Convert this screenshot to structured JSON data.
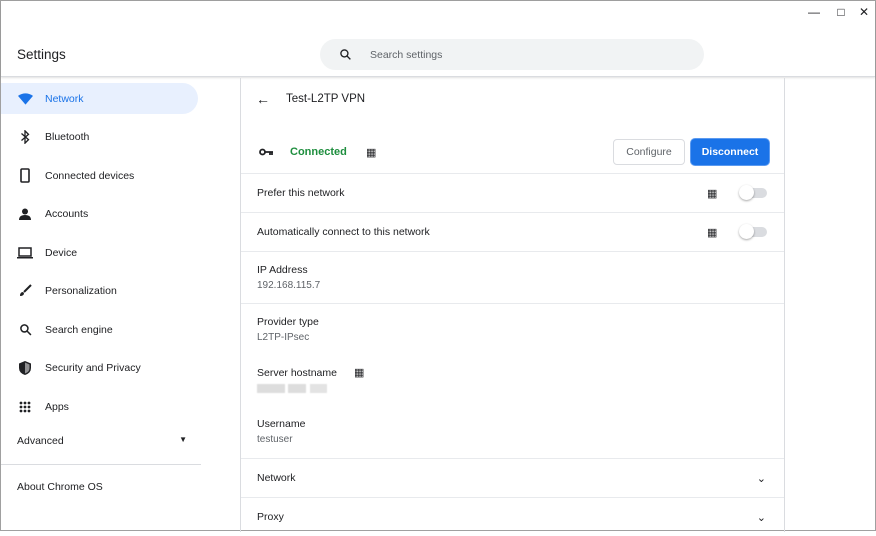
{
  "app": {
    "title": "Settings",
    "search_placeholder": "Search settings"
  },
  "window_controls": {
    "minimize": "—",
    "maximize": "□",
    "close": "✕"
  },
  "sidebar": {
    "items": [
      {
        "label": "Network",
        "icon": "wifi-icon"
      },
      {
        "label": "Bluetooth",
        "icon": "bluetooth-icon"
      },
      {
        "label": "Connected devices",
        "icon": "phone-icon"
      },
      {
        "label": "Accounts",
        "icon": "person-icon"
      },
      {
        "label": "Device",
        "icon": "laptop-icon"
      },
      {
        "label": "Personalization",
        "icon": "brush-icon"
      },
      {
        "label": "Search engine",
        "icon": "search-icon"
      },
      {
        "label": "Security and Privacy",
        "icon": "shield-icon"
      },
      {
        "label": "Apps",
        "icon": "apps-grid-icon"
      }
    ],
    "advanced": "Advanced",
    "about": "About Chrome OS"
  },
  "detail": {
    "title": "Test-L2TP VPN",
    "status": "Connected",
    "status_color": "#1e8e3e",
    "configure": "Configure",
    "disconnect": "Disconnect",
    "prefer": "Prefer this network",
    "prefer_on": false,
    "auto_connect": "Automatically connect to this network",
    "auto_on": false,
    "ip_label": "IP Address",
    "ip_value": "192.168.115.7",
    "provider_label": "Provider type",
    "provider_value": "L2TP-IPsec",
    "server_label": "Server hostname",
    "username_label": "Username",
    "username_value": "testuser",
    "network_section": "Network",
    "proxy_section": "Proxy"
  }
}
